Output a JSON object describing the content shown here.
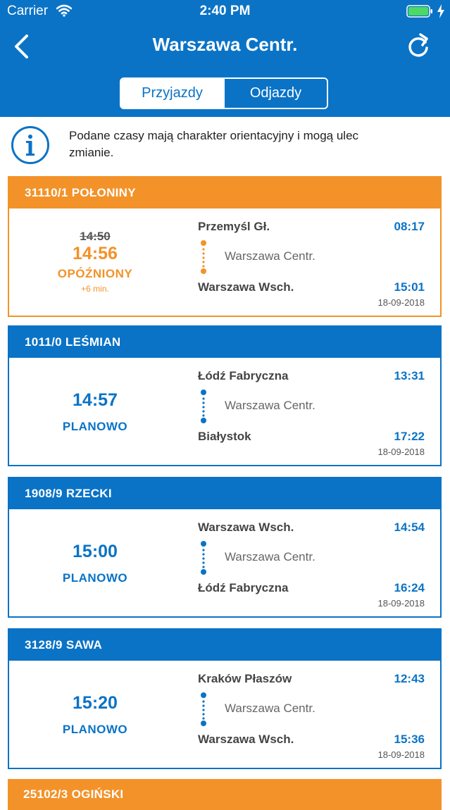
{
  "status_bar": {
    "carrier": "Carrier",
    "time": "2:40 PM"
  },
  "nav": {
    "title": "Warszawa Centr."
  },
  "segment": {
    "arrivals": "Przyjazdy",
    "departures": "Odjazdy"
  },
  "info": {
    "text": "Podane czasy mają charakter orientacyjny i mogą ulec zmianie."
  },
  "trains": [
    {
      "header": "31110/1 POŁONINY",
      "status_type": "delayed",
      "planned_time": "14:50",
      "actual_time": "14:56",
      "status": "OPÓŹNIONY",
      "delay": "+6 min.",
      "from": "Przemyśl Gł.",
      "from_time": "08:17",
      "via": "Warszawa Centr.",
      "to": "Warszawa Wsch.",
      "to_time": "15:01",
      "date": "18-09-2018"
    },
    {
      "header": "1011/0 LEŚMIAN",
      "status_type": "planned",
      "time": "14:57",
      "status": "PLANOWO",
      "from": "Łódź Fabryczna",
      "from_time": "13:31",
      "via": "Warszawa Centr.",
      "to": "Białystok",
      "to_time": "17:22",
      "date": "18-09-2018"
    },
    {
      "header": "1908/9 RZECKI",
      "status_type": "planned",
      "time": "15:00",
      "status": "PLANOWO",
      "from": "Warszawa Wsch.",
      "from_time": "14:54",
      "via": "Warszawa Centr.",
      "to": "Łódź Fabryczna",
      "to_time": "16:24",
      "date": "18-09-2018"
    },
    {
      "header": "3128/9 SAWA",
      "status_type": "planned",
      "time": "15:20",
      "status": "PLANOWO",
      "from": "Kraków Płaszów",
      "from_time": "12:43",
      "via": "Warszawa Centr.",
      "to": "Warszawa Wsch.",
      "to_time": "15:36",
      "date": "18-09-2018"
    },
    {
      "header": "25102/3 OGIŃSKI",
      "status_type": "delayed"
    }
  ],
  "colors": {
    "primary": "#0a73c6",
    "delayed": "#f39228"
  }
}
